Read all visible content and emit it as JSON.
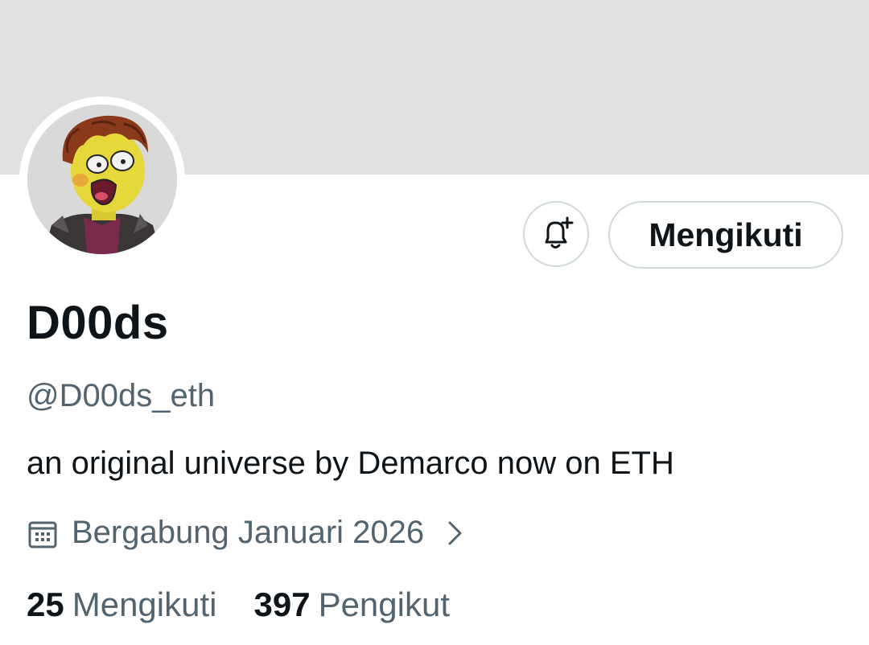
{
  "profile": {
    "display_name": "D00ds",
    "handle": "@D00ds_eth",
    "bio": "an original universe by Demarco now on ETH",
    "joined": "Bergabung Januari 2026",
    "avatar_icon": "cartoon-avatar",
    "banner_color": "#e1e1e1"
  },
  "actions": {
    "notify_icon": "bell-plus-icon",
    "follow_label": "Mengikuti"
  },
  "stats": {
    "following_count": "25",
    "following_label": "Mengikuti",
    "followers_count": "397",
    "followers_label": "Pengikut"
  },
  "colors": {
    "text_primary": "#0f1419",
    "text_secondary": "#536471",
    "border": "#cfd9de"
  }
}
